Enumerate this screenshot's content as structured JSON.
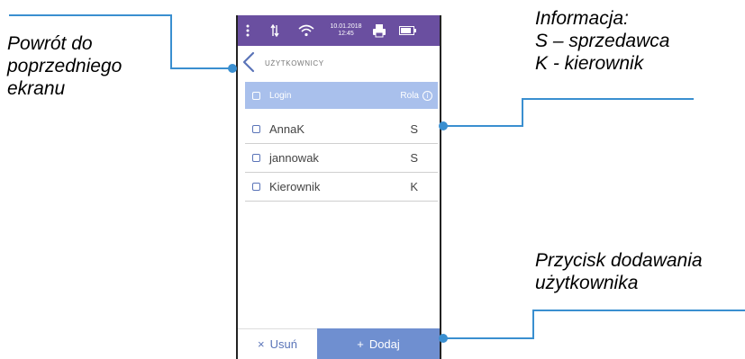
{
  "annotations": {
    "back": [
      "Powrót do",
      "poprzedniego",
      "ekranu"
    ],
    "info": [
      "Informacja:",
      "S – sprzedawca",
      "K - kierownik"
    ],
    "add": [
      "Przycisk dodawania",
      "użytkownika"
    ]
  },
  "status_bar": {
    "date": "10.01.2018",
    "time": "12:45"
  },
  "screen": {
    "title": "UŻYTKOWNICY",
    "header": {
      "login": "Login",
      "role": "Rola",
      "info_symbol": "i"
    },
    "users": [
      {
        "login": "AnnaK",
        "role": "S"
      },
      {
        "login": "jannowak",
        "role": "S"
      },
      {
        "login": "Kierownik",
        "role": "K"
      }
    ],
    "delete_label": "Usuń",
    "delete_icon": "×",
    "add_label": "Dodaj",
    "add_icon": "+"
  },
  "colors": {
    "status_bar": "#6a4fa0",
    "header_row": "#a9c0ec",
    "accent": "#5a74b8",
    "add_button": "#6f8fd0",
    "leader_lines": "#3a8fd0"
  }
}
